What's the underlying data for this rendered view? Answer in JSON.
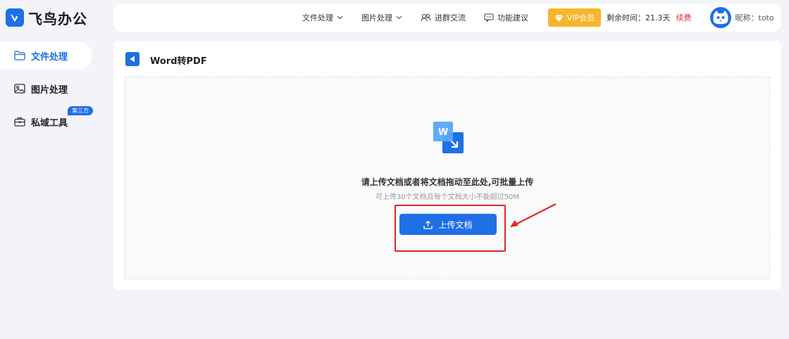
{
  "brand": {
    "name": "飞鸟办公"
  },
  "header": {
    "nav": [
      {
        "label": "文件处理",
        "icon": "chevron-down-icon"
      },
      {
        "label": "图片处理",
        "icon": "chevron-down-icon"
      }
    ],
    "group_chat": "进群交流",
    "feedback": "功能建议",
    "vip_label": "VIP会员",
    "remaining_time": "剩余时间：21.3天",
    "renew_label": "续费",
    "nickname": "昵称：toto"
  },
  "sidebar": {
    "items": [
      {
        "label": "文件处理",
        "icon": "folder-icon",
        "active": true
      },
      {
        "label": "图片处理",
        "icon": "image-icon",
        "active": false
      },
      {
        "label": "私域工具",
        "icon": "briefcase-icon",
        "active": false,
        "badge": "第三方"
      }
    ]
  },
  "main": {
    "title": "Word转PDF",
    "upload": {
      "file_badge": "W",
      "title": "请上传文档或者将文档拖动至此处,可批量上传",
      "subtitle": "可上传30个文档且每个文档大小不能超过50M",
      "button_label": "上传文档"
    }
  },
  "colors": {
    "accent": "#1f6fe5",
    "vip": "#f8b52c",
    "renew": "#e5302a",
    "annotation": "#e0262b",
    "background": "#f3f4f9"
  }
}
